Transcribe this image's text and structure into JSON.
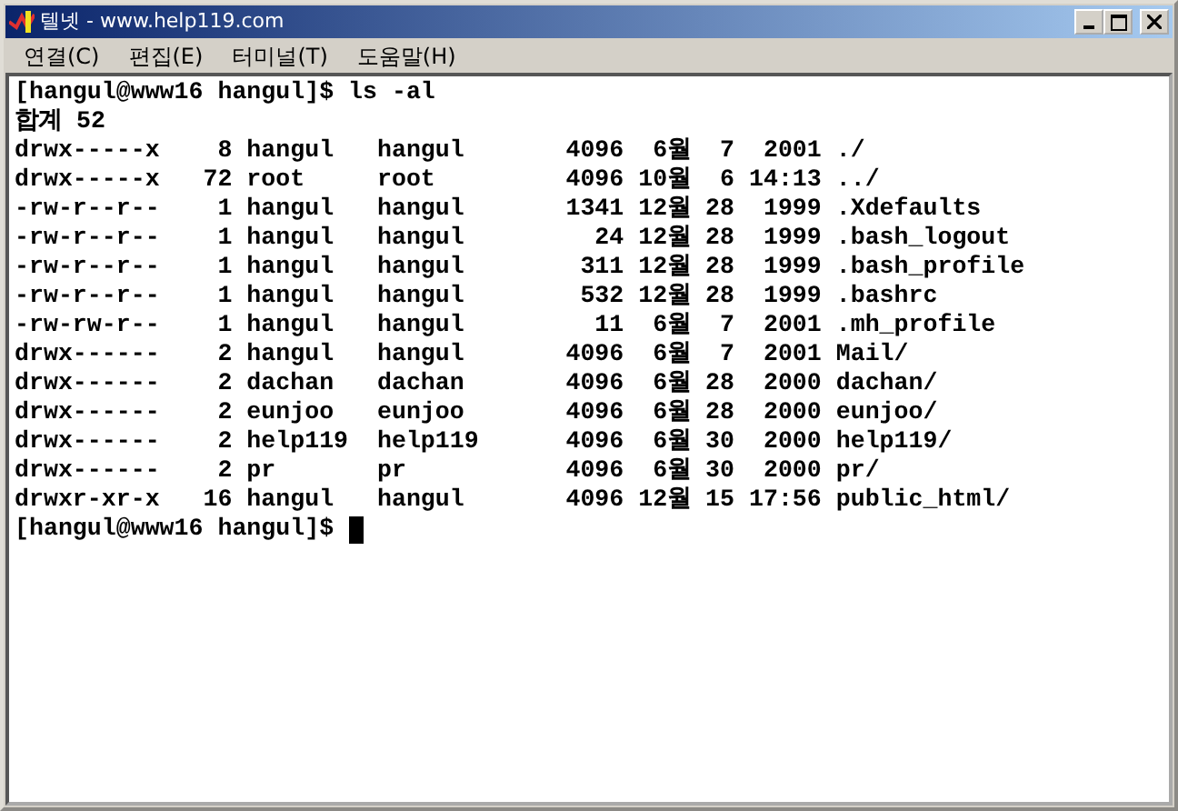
{
  "window": {
    "title": "텔넷 - www.help119.com"
  },
  "menu": [
    {
      "label": "연결(C)"
    },
    {
      "label": "편집(E)"
    },
    {
      "label": "터미널(T)"
    },
    {
      "label": "도움말(H)"
    }
  ],
  "terminal": {
    "lines": [
      "[hangul@www16 hangul]$ ls -al",
      "합계 52",
      "drwx-----x    8 hangul   hangul       4096  6월  7  2001 ./",
      "drwx-----x   72 root     root         4096 10월  6 14:13 ../",
      "-rw-r--r--    1 hangul   hangul       1341 12월 28  1999 .Xdefaults",
      "-rw-r--r--    1 hangul   hangul         24 12월 28  1999 .bash_logout",
      "-rw-r--r--    1 hangul   hangul        311 12월 28  1999 .bash_profile",
      "-rw-r--r--    1 hangul   hangul        532 12월 28  1999 .bashrc",
      "-rw-rw-r--    1 hangul   hangul         11  6월  7  2001 .mh_profile",
      "drwx------    2 hangul   hangul       4096  6월  7  2001 Mail/",
      "drwx------    2 dachan   dachan       4096  6월 28  2000 dachan/",
      "drwx------    2 eunjoo   eunjoo       4096  6월 28  2000 eunjoo/",
      "drwx------    2 help119  help119      4096  6월 30  2000 help119/",
      "drwx------    2 pr       pr           4096  6월 30  2000 pr/",
      "drwxr-xr-x   16 hangul   hangul       4096 12월 15 17:56 public_html/"
    ],
    "prompt": "[hangul@www16 hangul]$"
  }
}
